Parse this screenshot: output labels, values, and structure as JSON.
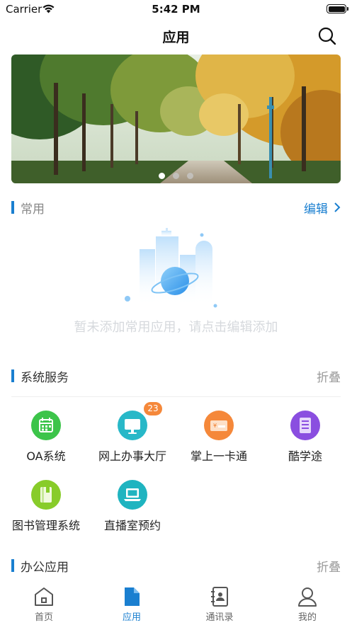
{
  "status_bar": {
    "carrier": "Carrier",
    "time": "5:42 PM"
  },
  "nav": {
    "title": "应用",
    "search_icon": "search-icon"
  },
  "banner": {
    "image": "autumn tree-lined avenue photo",
    "page_count": 3,
    "active_page": 1
  },
  "common": {
    "title": "常用",
    "edit_label": "编辑",
    "empty_message": "暂未添加常用应用，请点击编辑添加"
  },
  "system_services": {
    "title": "系统服务",
    "collapse_label": "折叠",
    "apps": [
      {
        "label": "OA系统",
        "icon": "calendar-icon",
        "color": "#3cc44a"
      },
      {
        "label": "网上办事大厅",
        "icon": "monitor-icon",
        "color": "#28b8c8",
        "badge": "23"
      },
      {
        "label": "掌上一卡通",
        "icon": "card-icon",
        "color": "#f5883a"
      },
      {
        "label": "酷学途",
        "icon": "list-icon",
        "color": "#8a4ee0"
      },
      {
        "label": "图书管理系统",
        "icon": "book-icon",
        "color": "#88cc2a"
      },
      {
        "label": "直播室预约",
        "icon": "laptop-icon",
        "color": "#1fb4c0"
      }
    ]
  },
  "office_apps": {
    "title": "办公应用",
    "collapse_label": "折叠"
  },
  "tabbar": {
    "tabs": [
      {
        "label": "首页",
        "icon": "home-icon"
      },
      {
        "label": "应用",
        "icon": "document-icon",
        "active": true
      },
      {
        "label": "通讯录",
        "icon": "contacts-icon"
      },
      {
        "label": "我的",
        "icon": "person-icon"
      }
    ]
  },
  "accent_color": "#1a7fd0"
}
